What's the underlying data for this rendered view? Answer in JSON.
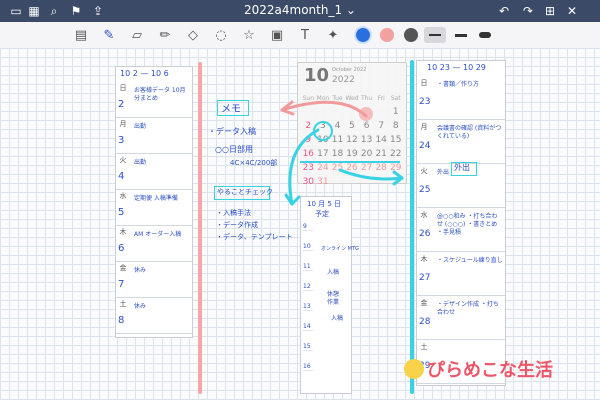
{
  "document": {
    "title": "2022a4month_1 ⌄"
  },
  "colors": {
    "ink": "#2b4fc4",
    "cyan": "#37d2e3",
    "pink": "#f29a9a",
    "gray": "#555555"
  },
  "toolbar": {
    "icons": [
      "undo-icon",
      "redo-icon",
      "add-page-icon",
      "close-icon"
    ]
  },
  "left_week": {
    "header": "10 2 — 10 6",
    "days": [
      {
        "dow": "日",
        "num": "2",
        "text": "お客様データ 10月分まとめ"
      },
      {
        "dow": "月",
        "num": "3",
        "text": "出勤"
      },
      {
        "dow": "火",
        "num": "4",
        "text": "出勤"
      },
      {
        "dow": "水",
        "num": "5",
        "text": "定期便 入稿準備"
      },
      {
        "dow": "木",
        "num": "6",
        "text": "AM オーダー入稿"
      },
      {
        "dow": "金",
        "num": "7",
        "text": "休み"
      },
      {
        "dow": "土",
        "num": "8",
        "text": "休み"
      }
    ]
  },
  "memo": {
    "title": "メモ",
    "lines": [
      "・データ入稿",
      "○○日部用",
      "4C×4C/200部"
    ],
    "todo_title": "やることチェック",
    "todo": [
      "・入稿手法",
      "・データ作成",
      "・データ、テンプレート"
    ]
  },
  "calendar": {
    "month": "10",
    "label": "October 2022",
    "year": "2022",
    "dow": [
      "Sun",
      "Mon",
      "Tue",
      "Wed",
      "Thu",
      "Fri",
      "Sat"
    ],
    "rows": [
      [
        "",
        "",
        "",
        "",
        "",
        "",
        "1"
      ],
      [
        "2",
        "3",
        "4",
        "5",
        "6",
        "7",
        "8"
      ],
      [
        "9",
        "10",
        "11",
        "12",
        "13",
        "14",
        "15"
      ],
      [
        "16",
        "17",
        "18",
        "19",
        "20",
        "21",
        "22"
      ],
      [
        "23",
        "24",
        "25",
        "26",
        "27",
        "28",
        "29"
      ],
      [
        "30",
        "31",
        "",
        "",
        "",
        "",
        ""
      ]
    ]
  },
  "timeline": {
    "title": "10 月 5 日",
    "sub": "予定",
    "entries": [
      "オンライン MTG",
      "入稿",
      "休憩",
      "作業",
      "入稿"
    ],
    "hours": [
      "9",
      "10",
      "11",
      "12",
      "13",
      "14",
      "15",
      "16"
    ]
  },
  "right_week": {
    "header": "10 23 — 10 29",
    "days": [
      {
        "dow": "日",
        "num": "23",
        "text": "・書類／作り方"
      },
      {
        "dow": "月",
        "num": "24",
        "text": "会議書の確認 (資料がつくれている)"
      },
      {
        "dow": "火",
        "num": "25",
        "text": "外出"
      },
      {
        "dow": "水",
        "num": "26",
        "text": "@○○和み ・打ち合わせ (○○○) ・書きとめ ・手見積"
      },
      {
        "dow": "木",
        "num": "27",
        "text": "・スケジュール練り直し"
      },
      {
        "dow": "金",
        "num": "28",
        "text": "・デザイン作成 ・打ち合わせ"
      },
      {
        "dow": "土",
        "num": "29",
        "text": ""
      }
    ],
    "tag": "外出"
  },
  "logo": {
    "text": "ぴらめこな生活"
  }
}
